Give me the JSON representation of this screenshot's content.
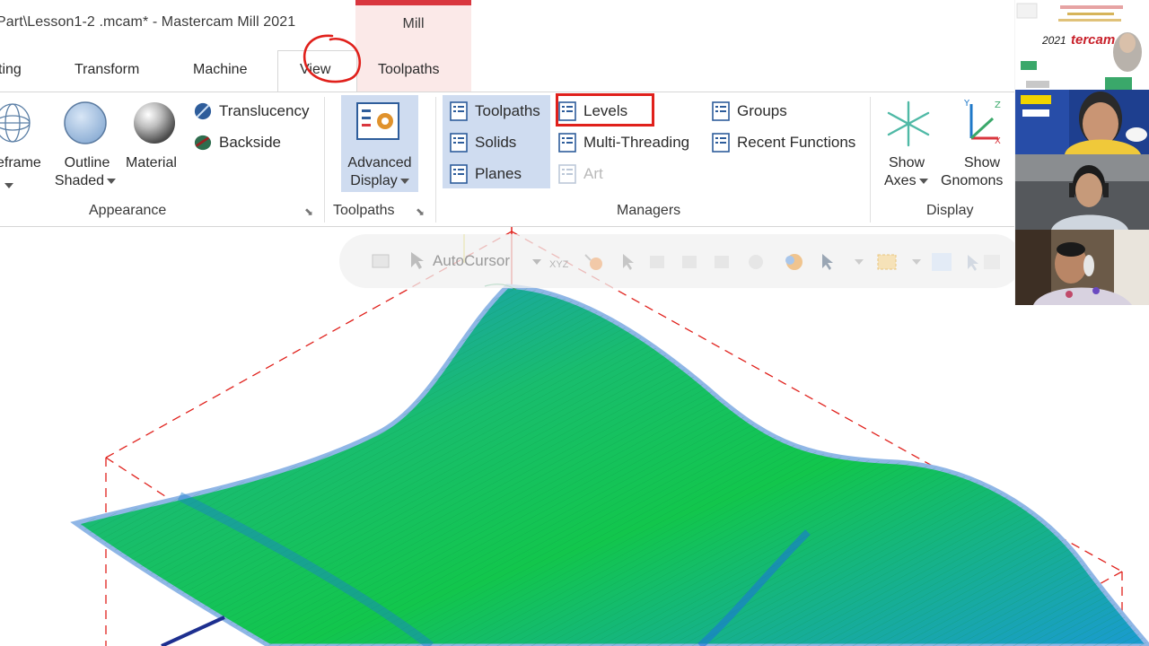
{
  "window": {
    "title": "Part\\Lesson1-2 .mcam* - Mastercam Mill 2021",
    "context_tab": "Mill"
  },
  "tabs": [
    {
      "label": "ting"
    },
    {
      "label": "Transform"
    },
    {
      "label": "Machine"
    },
    {
      "label": "View",
      "active": true
    },
    {
      "label": "Toolpaths"
    }
  ],
  "ribbon": {
    "appearance": {
      "label": "Appearance",
      "wireframe": "eframe",
      "outline_shaded": [
        "Outline",
        "Shaded"
      ],
      "material": "Material",
      "translucency": "Translucency",
      "backside": "Backside"
    },
    "toolpaths_group": {
      "label": "Toolpaths",
      "advanced_display": [
        "Advanced",
        "Display"
      ]
    },
    "managers": {
      "label": "Managers",
      "toolpaths": "Toolpaths",
      "solids": "Solids",
      "planes": "Planes",
      "levels": "Levels",
      "multi_threading": "Multi-Threading",
      "art": "Art",
      "groups": "Groups",
      "recent_functions": "Recent Functions"
    },
    "display": {
      "label": "Display",
      "show_axes": [
        "Show",
        "Axes"
      ],
      "show_gnomons": [
        "Show",
        "Gnomons"
      ]
    }
  },
  "viewport": {
    "autocursor_label": "AutoCursor",
    "xyz_label": "XYZ"
  },
  "webcam": {
    "poster_brand": "tercam",
    "poster_year": "2021"
  },
  "colors": {
    "accent_red": "#d9363e",
    "highlight_blue": "#cfdcf0",
    "surface_green": "#17c46a",
    "surface_blue": "#1f8ad9",
    "annotation_red": "#e0201b"
  },
  "icons": {
    "manager_icon": "list-panel-icon",
    "levels_highlight": "red-rectangle"
  }
}
